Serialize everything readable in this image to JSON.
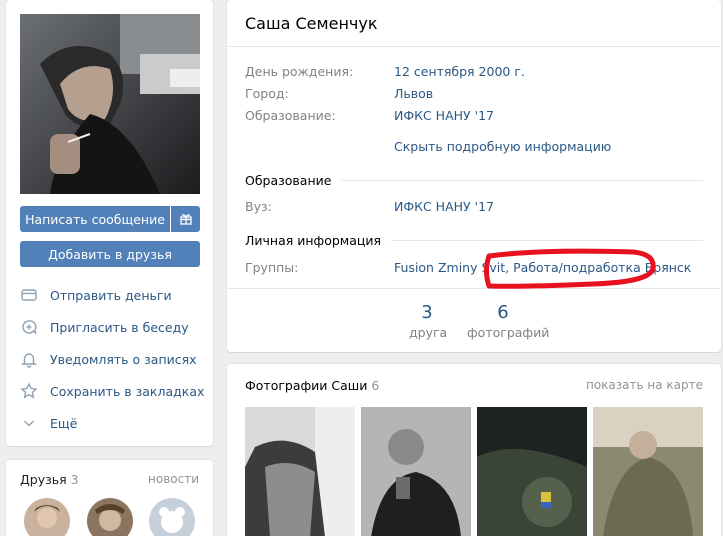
{
  "sidebar": {
    "send_message_label": "Написать сообщение",
    "add_friend_label": "Добавить в друзья",
    "actions": [
      {
        "label": "Отправить деньги",
        "icon": "money-icon"
      },
      {
        "label": "Пригласить в беседу",
        "icon": "invite-chat-icon"
      },
      {
        "label": "Уведомлять о записях",
        "icon": "bell-icon"
      },
      {
        "label": "Сохранить в закладках",
        "icon": "star-icon"
      },
      {
        "label": "Ещё",
        "icon": "chevron-down-icon"
      }
    ]
  },
  "friends": {
    "title": "Друзья",
    "count": "3",
    "news_link": "новости"
  },
  "profile": {
    "name": "Саша Семенчук",
    "info": [
      {
        "label": "День рождения:",
        "value": "12 сентября 2000 г."
      },
      {
        "label": "Город:",
        "value": "Львов"
      },
      {
        "label": "Образование:",
        "value": "ИФКС НАНУ '17"
      }
    ],
    "hide_info_link": "Скрыть подробную информацию",
    "education_section": "Образование",
    "education_rows": [
      {
        "label": "Вуз:",
        "value": "ИФКС НАНУ '17"
      }
    ],
    "personal_section": "Личная информация",
    "groups_label": "Группы:",
    "groups_value": "Fusion Zminy Svit, Работа/подработка Брянск",
    "counters": [
      {
        "num": "3",
        "caption": "друга"
      },
      {
        "num": "6",
        "caption": "фотографий"
      }
    ]
  },
  "photos": {
    "title": "Фотографии Саши",
    "count": "6",
    "map_link": "показать на карте"
  },
  "colors": {
    "accent": "#5181b8",
    "link": "#2a5885",
    "highlight": "#e8121e"
  }
}
